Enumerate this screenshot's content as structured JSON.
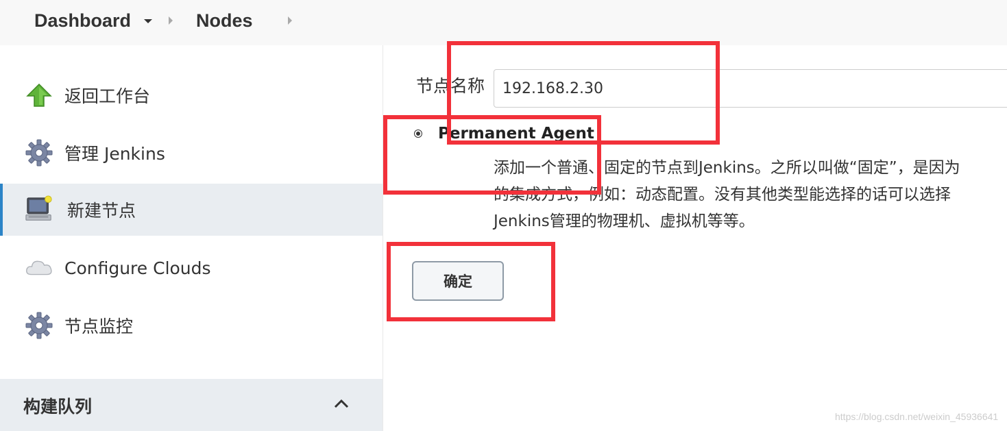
{
  "breadcrumb": {
    "items": [
      {
        "label": "Dashboard"
      },
      {
        "label": "Nodes"
      }
    ]
  },
  "sidebar": {
    "items": [
      {
        "label": "返回工作台",
        "icon": "up-arrow-icon"
      },
      {
        "label": "管理 Jenkins",
        "icon": "gear-icon"
      },
      {
        "label": "新建节点",
        "icon": "computer-icon",
        "active": true
      },
      {
        "label": "Configure Clouds",
        "icon": "cloud-icon"
      },
      {
        "label": "节点监控",
        "icon": "gear-icon"
      }
    ]
  },
  "build_queue": {
    "title": "构建队列"
  },
  "form": {
    "node_name_label": "节点名称",
    "node_name_value": "192.168.2.30",
    "agent_type_label": "Permanent Agent",
    "agent_type_selected": true,
    "description_lines": [
      "添加一个普通、固定的节点到Jenkins。之所以叫做“固定”，是因为",
      "的集成方式，例如：动态配置。没有其他类型能选择的话可以选择",
      "Jenkins管理的物理机、虚拟机等等。"
    ],
    "ok_button": "确定"
  },
  "watermark": "https://blog.csdn.net/weixin_45936641",
  "colors": {
    "annotation": "#f2313a",
    "active_accent": "#2c84c7",
    "sidebar_active_bg": "#e9edf1"
  }
}
